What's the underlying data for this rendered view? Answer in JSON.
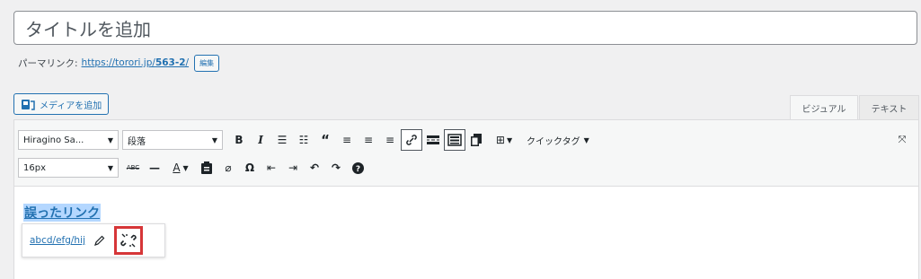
{
  "title_placeholder": "タイトルを追加",
  "permalink": {
    "label": "パーマリンク:",
    "url_base": "https://torori.jp/",
    "slug": "563-2",
    "trailing_slash": "/",
    "edit_label": "編集"
  },
  "media_button": "メディアを追加",
  "tabs": {
    "visual": "ビジュアル",
    "text": "テキスト"
  },
  "toolbar": {
    "font_family": "Hiragino Sa...",
    "format": "段落",
    "font_size": "16px",
    "quick_tag": "クイックタグ"
  },
  "content": {
    "link_text": "誤ったリンク"
  },
  "link_popup": {
    "url": "abcd/efg/hij"
  },
  "colors": {
    "accent": "#2271b1",
    "highlight": "#d63638"
  }
}
